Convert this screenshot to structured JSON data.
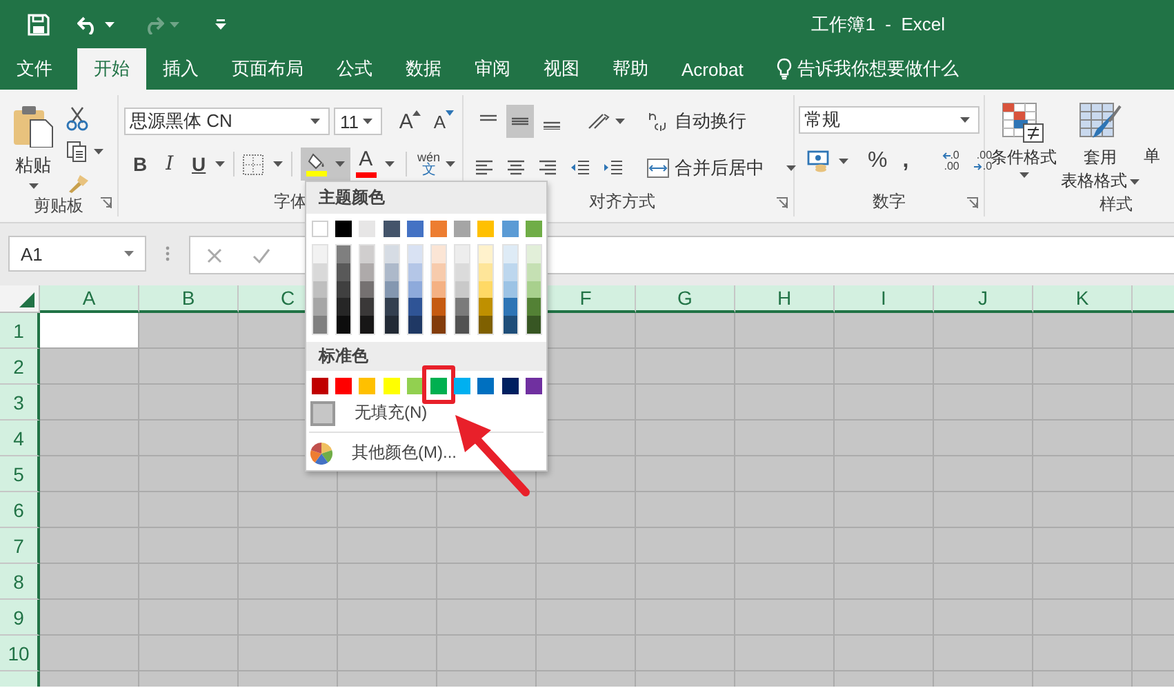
{
  "title_bar": {
    "title": "工作簿1  -  Excel",
    "redo": {
      "disabled": true
    }
  },
  "tabs": [
    {
      "label": "文件",
      "selected": false
    },
    {
      "label": "开始",
      "selected": true
    },
    {
      "label": "插入",
      "selected": false
    },
    {
      "label": "页面布局",
      "selected": false
    },
    {
      "label": "公式",
      "selected": false
    },
    {
      "label": "数据",
      "selected": false
    },
    {
      "label": "审阅",
      "selected": false
    },
    {
      "label": "视图",
      "selected": false
    },
    {
      "label": "帮助",
      "selected": false
    },
    {
      "label": "Acrobat",
      "selected": false
    }
  ],
  "tell_me": "告诉我你想要做什么",
  "ribbon": {
    "clipboard": {
      "paste": "粘贴",
      "label": "剪贴板"
    },
    "font": {
      "font_name": "思源黑体 CN",
      "font_size": "11",
      "grow": "A",
      "shrink": "A",
      "bold": "B",
      "italic": "I",
      "underline": "U",
      "fill_color": {
        "color": "#ffff00",
        "pressed": true
      },
      "font_color": {
        "letter": "A",
        "color": "#ff0000"
      },
      "phonetic": {
        "top": "wén",
        "bottom": "文"
      },
      "label": "字体"
    },
    "alignment": {
      "vertical_align": [
        {
          "selected": false
        },
        {
          "selected": true
        },
        {
          "selected": false
        }
      ],
      "wrap_text": "自动换行",
      "merge_center": "合并后居中",
      "label": "对齐方式"
    },
    "number": {
      "format": "常规",
      "percent": "%",
      "comma": ",",
      "increase_decimal": [
        ".0",
        ".00"
      ],
      "decrease_decimal": [
        ".00",
        ".0"
      ],
      "label": "数字"
    },
    "styles": {
      "conditional_format": "条件格式",
      "format_as_table": [
        "套用",
        "表格格式"
      ],
      "cell_styles": "单",
      "label": "样式"
    }
  },
  "name_box": "A1",
  "sheet": {
    "columns": [
      {
        "kind": "labeled",
        "label": "A",
        "selected": true
      },
      {
        "kind": "labeled",
        "label": "B",
        "selected": true
      },
      {
        "kind": "labeled",
        "label": "C",
        "selected": true
      },
      {
        "kind": "covered"
      },
      {
        "kind": "covered"
      },
      {
        "kind": "labeled",
        "label": "F",
        "selected": true
      },
      {
        "kind": "labeled",
        "label": "G",
        "selected": true
      },
      {
        "kind": "labeled",
        "label": "H",
        "selected": true
      },
      {
        "kind": "labeled",
        "label": "I",
        "selected": true
      },
      {
        "kind": "labeled",
        "label": "J",
        "selected": true
      },
      {
        "kind": "labeled",
        "label": "K",
        "selected": true
      }
    ],
    "rows": [
      {
        "label": "1",
        "selected": true
      },
      {
        "label": "2",
        "selected": true
      },
      {
        "label": "3",
        "selected": true
      },
      {
        "label": "4",
        "selected": true
      },
      {
        "label": "5",
        "selected": true
      },
      {
        "label": "6",
        "selected": true
      },
      {
        "label": "7",
        "selected": true
      },
      {
        "label": "8",
        "selected": true
      },
      {
        "label": "9",
        "selected": true
      },
      {
        "label": "10",
        "selected": true
      }
    ]
  },
  "color_menu": {
    "theme_title": "主题颜色",
    "theme_colors": [
      {
        "color": "#ffffff",
        "shades": [
          {
            "color": "#f2f2f2"
          },
          {
            "color": "#d9d9d9"
          },
          {
            "color": "#bfbfbf"
          },
          {
            "color": "#a6a6a6"
          },
          {
            "color": "#808080"
          }
        ]
      },
      {
        "color": "#000000",
        "shades": [
          {
            "color": "#7f7f7f"
          },
          {
            "color": "#595959"
          },
          {
            "color": "#404040"
          },
          {
            "color": "#262626"
          },
          {
            "color": "#0d0d0d"
          }
        ]
      },
      {
        "color": "#e7e6e6",
        "shades": [
          {
            "color": "#d0cece"
          },
          {
            "color": "#aeaaaa"
          },
          {
            "color": "#757171"
          },
          {
            "color": "#3a3838"
          },
          {
            "color": "#171616"
          }
        ]
      },
      {
        "color": "#44546a",
        "shades": [
          {
            "color": "#d6dce4"
          },
          {
            "color": "#adb9ca"
          },
          {
            "color": "#8497b0"
          },
          {
            "color": "#333f4f"
          },
          {
            "color": "#222a35"
          }
        ]
      },
      {
        "color": "#4472c4",
        "shades": [
          {
            "color": "#d9e2f3"
          },
          {
            "color": "#b4c6e7"
          },
          {
            "color": "#8eaadb"
          },
          {
            "color": "#2f5496"
          },
          {
            "color": "#1f3864"
          }
        ]
      },
      {
        "color": "#ed7d31",
        "shades": [
          {
            "color": "#fbe5d5"
          },
          {
            "color": "#f7cbac"
          },
          {
            "color": "#f4b183"
          },
          {
            "color": "#c55a11"
          },
          {
            "color": "#833c0b"
          }
        ]
      },
      {
        "color": "#a5a5a5",
        "shades": [
          {
            "color": "#ededed"
          },
          {
            "color": "#dbdbdb"
          },
          {
            "color": "#c9c9c9"
          },
          {
            "color": "#7b7b7b"
          },
          {
            "color": "#525252"
          }
        ]
      },
      {
        "color": "#ffc000",
        "shades": [
          {
            "color": "#fff2cc"
          },
          {
            "color": "#fee599"
          },
          {
            "color": "#ffd965"
          },
          {
            "color": "#bf9000"
          },
          {
            "color": "#7f6000"
          }
        ]
      },
      {
        "color": "#5b9bd5",
        "shades": [
          {
            "color": "#deebf6"
          },
          {
            "color": "#bdd7ee"
          },
          {
            "color": "#9cc3e5"
          },
          {
            "color": "#2e75b5"
          },
          {
            "color": "#1f4e79"
          }
        ]
      },
      {
        "color": "#70ad47",
        "shades": [
          {
            "color": "#e2efd9"
          },
          {
            "color": "#c5e0b3"
          },
          {
            "color": "#a8d08d"
          },
          {
            "color": "#538135"
          },
          {
            "color": "#375623"
          }
        ]
      }
    ],
    "standard_title": "标准色",
    "standard_colors": [
      {
        "color": "#c00000",
        "highlighted": false
      },
      {
        "color": "#ff0000",
        "highlighted": false
      },
      {
        "color": "#ffc000",
        "highlighted": false
      },
      {
        "color": "#ffff00",
        "highlighted": false
      },
      {
        "color": "#92d050",
        "highlighted": false
      },
      {
        "color": "#00b050",
        "highlighted": true
      },
      {
        "color": "#00b0f0",
        "highlighted": false
      },
      {
        "color": "#0070c0",
        "highlighted": false
      },
      {
        "color": "#002060",
        "highlighted": false
      },
      {
        "color": "#7030a0",
        "highlighted": false
      }
    ],
    "no_fill": "无填充(N)",
    "more_colors": "其他颜色(M)..."
  }
}
